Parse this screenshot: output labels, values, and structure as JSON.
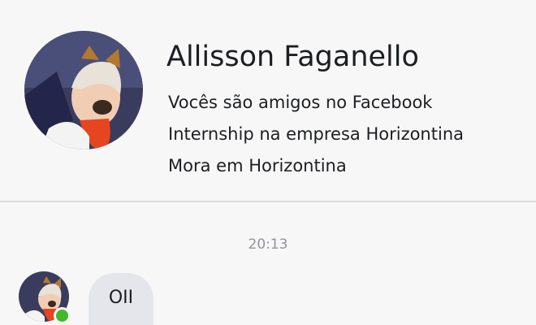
{
  "profile": {
    "name": "Allisson Faganello",
    "friendship": "Vocês são amigos no Facebook",
    "work": "Internship na empresa Horizontina",
    "location": "Mora em Horizontina"
  },
  "conversation": {
    "timestamp": "20:13",
    "messages": [
      {
        "text": "OII",
        "sender": "contact"
      }
    ],
    "contact_online": true
  },
  "colors": {
    "online": "#42b72a",
    "bubble": "#e4e6eb",
    "timestamp": "#90949c"
  },
  "icons": {
    "avatar": "profile-photo-with-dog-filter",
    "presence": "online-dot"
  }
}
